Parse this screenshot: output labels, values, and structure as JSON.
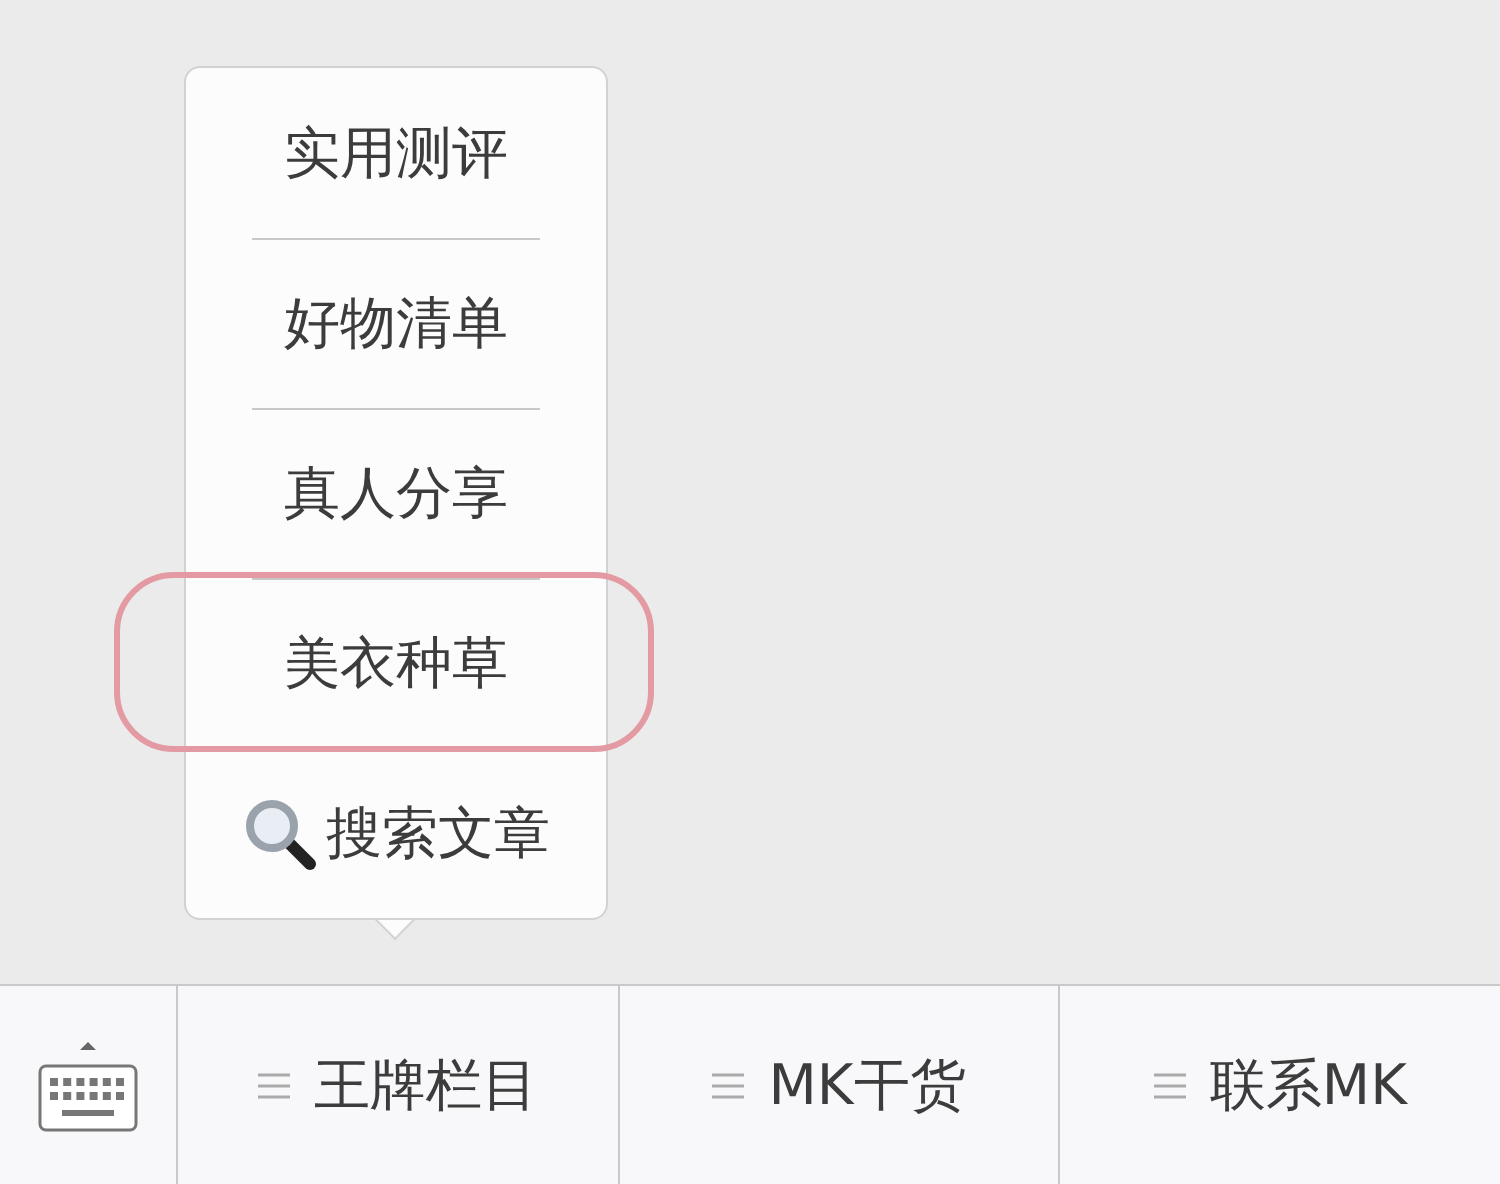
{
  "submenu": {
    "items": [
      {
        "label": "实用测评",
        "kind": "text",
        "circled": false
      },
      {
        "label": "好物清单",
        "kind": "text",
        "circled": false
      },
      {
        "label": "真人分享",
        "kind": "text",
        "circled": false
      },
      {
        "label": "美衣种草",
        "kind": "text",
        "circled": true
      },
      {
        "label": "搜索文章",
        "kind": "search",
        "circled": false
      }
    ]
  },
  "menu_bar": {
    "items": [
      {
        "label": "王牌栏目"
      },
      {
        "label": "MK干货"
      },
      {
        "label": "联系MK"
      }
    ]
  }
}
